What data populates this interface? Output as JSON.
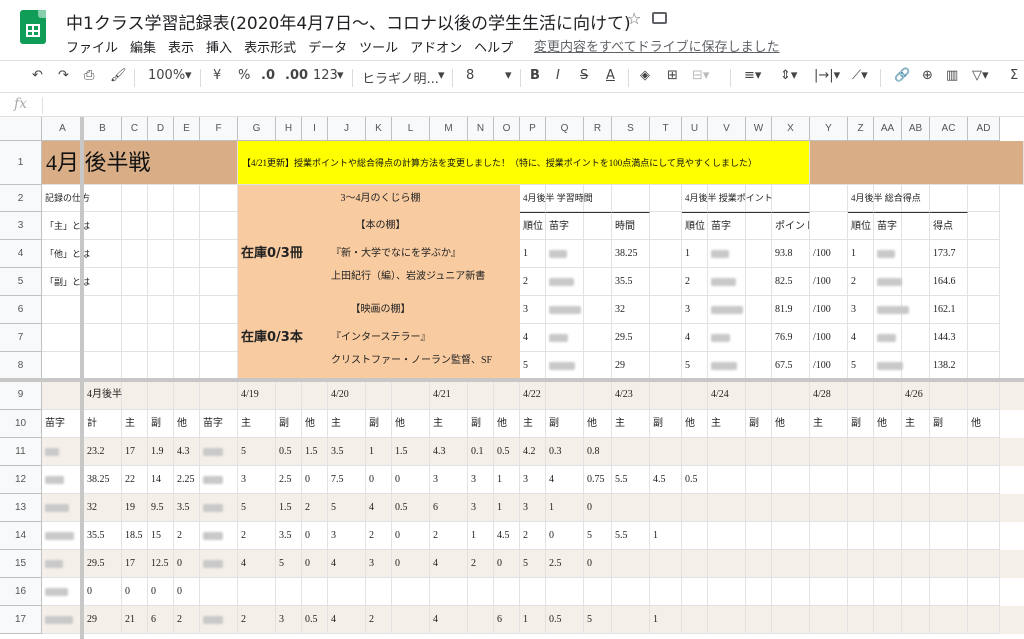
{
  "app": {
    "title": "中1クラス学習記録表(2020年4月7日〜、コロナ以後の学生生活に向けて)",
    "menu": [
      "ファイル",
      "編集",
      "表示",
      "挿入",
      "表示形式",
      "データ",
      "ツール",
      "アドオン",
      "ヘルプ"
    ],
    "save_status": "変更内容をすべてドライブに保存しました"
  },
  "toolbar": {
    "zoom": "100%",
    "currency": "¥",
    "percent": "%",
    "dec_decrease": ".0",
    "dec_increase": ".00",
    "format_more": "123",
    "font": "ヒラギノ明...",
    "font_size": "8"
  },
  "formula_bar": {
    "fx": "fx",
    "value": ""
  },
  "columns": [
    "A",
    "B",
    "C",
    "D",
    "E",
    "F",
    "G",
    "H",
    "I",
    "J",
    "K",
    "L",
    "M",
    "N",
    "O",
    "P",
    "Q",
    "R",
    "S",
    "T",
    "U",
    "V",
    "W",
    "X",
    "Y",
    "Z",
    "AA",
    "AB",
    "AC",
    "AD"
  ],
  "rows": [
    "1",
    "2",
    "3",
    "4",
    "5",
    "6",
    "7",
    "8",
    "9",
    "10",
    "11",
    "12",
    "13",
    "14",
    "15",
    "16",
    "17"
  ],
  "colors": {
    "title_bg": "#d9ae87",
    "notice_bg": "#ffff00",
    "library_bg": "#f8cba1",
    "band_bg": "#f4efe8"
  },
  "sheet": {
    "title": "4月 後半戦",
    "notice": "【4/21更新】授業ポイントや総合得点の計算方法を変更しました！（特に、授業ポイントを100点満点にして見やすくしました）",
    "side_labels": [
      "記録の仕方",
      "「主」とは",
      "「他」とは",
      "「副」とは"
    ],
    "library_title": "3〜4月のくじら棚",
    "book_header": "【本の棚】",
    "book_stock": "在庫0/3冊",
    "book_title": "『新・大学でなにを学ぶか』",
    "book_author": "上田紀行（編）、岩波ジュニア新書",
    "movie_header": "【映画の棚】",
    "movie_stock": "在庫0/3本",
    "movie_title": "『インターステラー』",
    "movie_author": "クリストファー・ノーラン監督、SF",
    "rank_study": {
      "title": "4月後半 学習時間",
      "headers": [
        "順位",
        "苗字",
        "時間"
      ],
      "rows": [
        [
          "1",
          "38.25"
        ],
        [
          "2",
          "35.5"
        ],
        [
          "3",
          "32"
        ],
        [
          "4",
          "29.5"
        ],
        [
          "5",
          "29"
        ]
      ]
    },
    "rank_class": {
      "title": "4月後半 授業ポイント",
      "headers": [
        "順位",
        "苗字",
        "ポイント"
      ],
      "rows": [
        [
          "1",
          "93.8",
          "/100"
        ],
        [
          "2",
          "82.5",
          "/100"
        ],
        [
          "3",
          "81.9",
          "/100"
        ],
        [
          "4",
          "76.9",
          "/100"
        ],
        [
          "5",
          "67.5",
          "/100"
        ]
      ]
    },
    "rank_total": {
      "title": "4月後半 総合得点",
      "headers": [
        "順位",
        "苗字",
        "得点"
      ],
      "rows": [
        [
          "1",
          "173.7"
        ],
        [
          "2",
          "164.6"
        ],
        [
          "3",
          "162.1"
        ],
        [
          "4",
          "144.3"
        ],
        [
          "5",
          "138.2"
        ]
      ]
    },
    "row9": [
      "4月後半",
      "4/19",
      "4/20",
      "4/21",
      "4/22",
      "4/23",
      "4/24",
      "4/28",
      "4/26"
    ],
    "row10": [
      "苗字",
      "計",
      "主",
      "副",
      "他",
      "苗字",
      "主",
      "副",
      "他",
      "主",
      "副",
      "他",
      "主",
      "副",
      "他",
      "主",
      "副",
      "他",
      "主",
      "副",
      "他",
      "主",
      "副",
      "他",
      "主",
      "副",
      "他",
      "主",
      "副",
      "他"
    ],
    "data_rows": [
      [
        "23.2",
        "17",
        "1.9",
        "4.3",
        "5",
        "0.5",
        "1.5",
        "3.5",
        "1",
        "1.5",
        "4.3",
        "0.1",
        "0.5",
        "4.2",
        "0.3",
        "0.8"
      ],
      [
        "38.25",
        "22",
        "14",
        "2.25",
        "3",
        "2.5",
        "0",
        "7.5",
        "0",
        "0",
        "3",
        "3",
        "1",
        "3",
        "4",
        "0.75",
        "5.5",
        "4.5",
        "0.5"
      ],
      [
        "32",
        "19",
        "9.5",
        "3.5",
        "5",
        "1.5",
        "2",
        "5",
        "4",
        "0.5",
        "6",
        "3",
        "1",
        "3",
        "1",
        "0"
      ],
      [
        "35.5",
        "18.5",
        "15",
        "2",
        "2",
        "3.5",
        "0",
        "3",
        "2",
        "0",
        "2",
        "1",
        "4.5",
        "2",
        "0",
        "5",
        "5.5",
        "1"
      ],
      [
        "29.5",
        "17",
        "12.5",
        "0",
        "4",
        "5",
        "0",
        "4",
        "3",
        "0",
        "4",
        "2",
        "0",
        "5",
        "2.5",
        "0"
      ],
      [
        "0",
        "0",
        "0",
        "0"
      ],
      [
        "29",
        "21",
        "6",
        "2",
        "2",
        "3",
        "0.5",
        "4",
        "2",
        "",
        "4",
        "",
        "6",
        "1",
        "0.5",
        "5",
        "",
        "1"
      ]
    ]
  }
}
